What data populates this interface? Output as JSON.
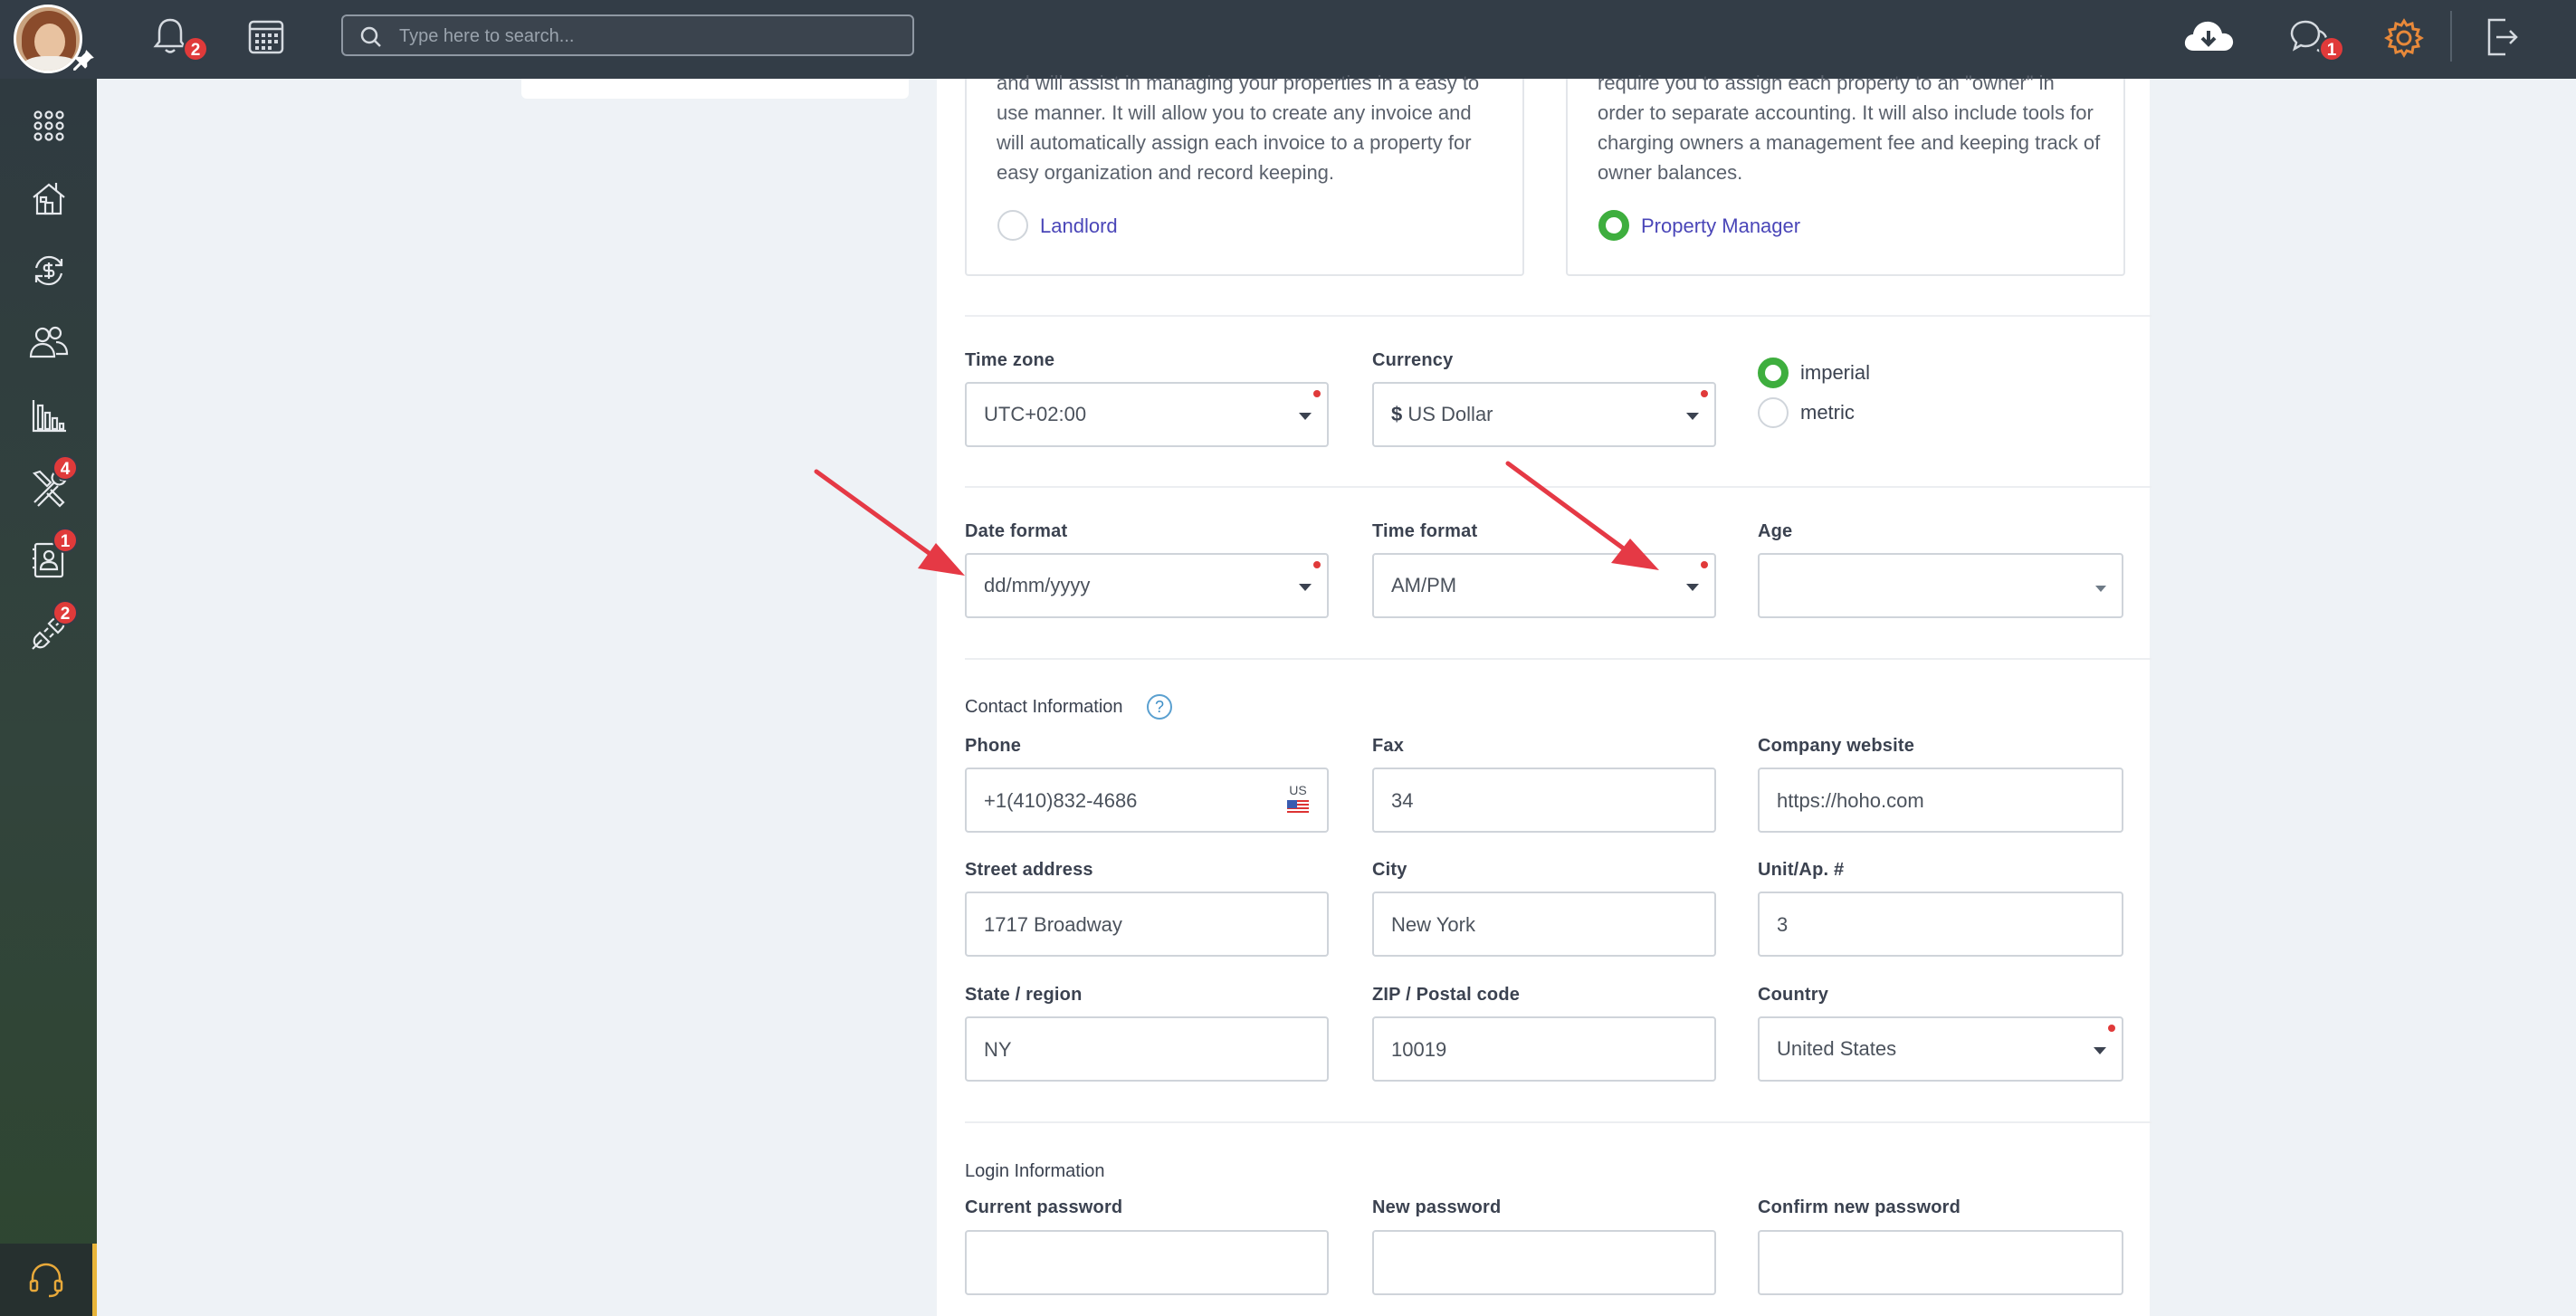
{
  "topbar": {
    "notifications_count": "2",
    "search_placeholder": "Type here to search...",
    "messages_count": "1"
  },
  "sidebar": {
    "items": [
      {
        "icon": "apps-grid-icon"
      },
      {
        "icon": "properties-icon"
      },
      {
        "icon": "transactions-icon"
      },
      {
        "icon": "people-icon"
      },
      {
        "icon": "reports-icon"
      },
      {
        "icon": "maintenance-icon",
        "badge": "4"
      },
      {
        "icon": "contacts-icon",
        "badge": "1"
      },
      {
        "icon": "integrations-icon",
        "badge": "2"
      }
    ],
    "bottom_icon": "support-headset-icon"
  },
  "roles": {
    "landlord": {
      "description_lines": [
        "and will assist in managing your properties in a easy to",
        "use manner. It will allow you to create any invoice and",
        "will automatically assign each invoice to a property for",
        "easy organization and record keeping."
      ],
      "label": "Landlord",
      "selected": false
    },
    "manager": {
      "description_lines": [
        "require you to assign each property to an \"owner\" in",
        "order to separate accounting. It will also include tools for",
        "charging owners a management fee and keeping track of",
        "owner balances."
      ],
      "label": "Property Manager",
      "selected": true
    }
  },
  "preferences": {
    "timezone_label": "Time zone",
    "timezone_value": "UTC+02:00",
    "currency_label": "Currency",
    "currency_symbol": "$",
    "currency_value": "US Dollar",
    "units": [
      {
        "label": "imperial",
        "selected": true
      },
      {
        "label": "metric",
        "selected": false
      }
    ],
    "date_format_label": "Date format",
    "date_format_value": "dd/mm/yyyy",
    "time_format_label": "Time format",
    "time_format_value": "AM/PM",
    "age_label": "Age",
    "age_value": ""
  },
  "contact": {
    "section_title": "Contact Information",
    "help_glyph": "?",
    "phone_label": "Phone",
    "phone_value": "+1(410)832-4686",
    "phone_country": "US",
    "fax_label": "Fax",
    "fax_value": "34",
    "website_label": "Company website",
    "website_value": "https://hoho.com",
    "street_label": "Street address",
    "street_value": "1717 Broadway",
    "city_label": "City",
    "city_value": "New York",
    "unit_label": "Unit/Ap. #",
    "unit_value": "3",
    "state_label": "State / region",
    "state_value": "NY",
    "zip_label": "ZIP / Postal code",
    "zip_value": "10019",
    "country_label": "Country",
    "country_value": "United States"
  },
  "login": {
    "section_title": "Login Information",
    "current_label": "Current password",
    "new_label": "New password",
    "confirm_label": "Confirm new password"
  },
  "colors": {
    "topbar": "#333d47",
    "accent_green": "#3eae3e",
    "badge_red": "#e03a3a",
    "link_purple": "#4a46b8",
    "settings_orange": "#e8893a",
    "arrow_red": "#e53945"
  }
}
